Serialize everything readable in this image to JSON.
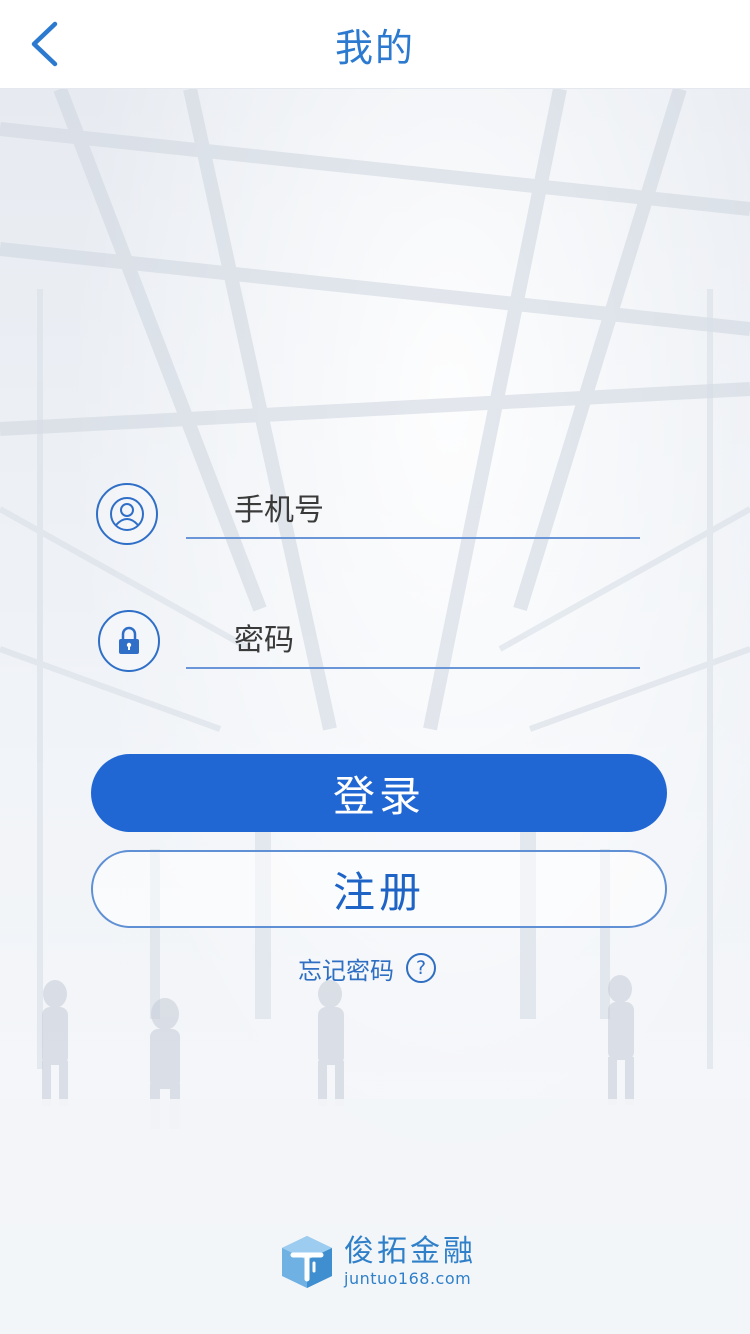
{
  "header": {
    "title": "我的",
    "back_icon": "chevron-left-icon"
  },
  "form": {
    "phone": {
      "placeholder": "手机号",
      "icon": "user-icon"
    },
    "password": {
      "placeholder": "密码",
      "icon": "lock-icon"
    },
    "login_label": "登录",
    "register_label": "注册",
    "forgot_label": "忘记密码",
    "forgot_icon_glyph": "?"
  },
  "brand": {
    "name": "俊拓金融",
    "url": "juntuo168.com"
  },
  "colors": {
    "primary": "#2067d4",
    "title_blue": "#2b7ad0",
    "outline_blue": "#5f8fd4",
    "brand_blue": "#2f80c9"
  }
}
